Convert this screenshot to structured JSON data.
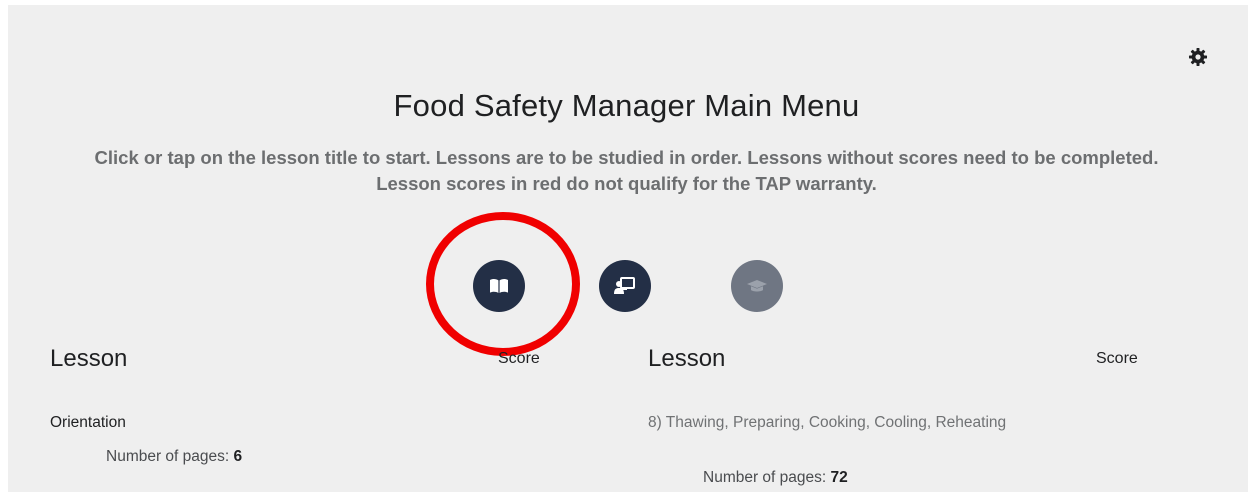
{
  "header": {
    "title": "Food Safety Manager Main Menu",
    "instructions": "Click or tap on the lesson title to start. Lessons are to be studied in order. Lessons without scores need to be completed. Lesson scores in red do not qualify for the TAP warranty."
  },
  "toolbar": {
    "settings_icon": "gear-icon",
    "mode_buttons": [
      {
        "icon": "open-book-icon",
        "state": "active",
        "highlighted": true
      },
      {
        "icon": "presentation-icon",
        "state": "enabled"
      },
      {
        "icon": "graduation-cap-icon",
        "state": "disabled"
      }
    ]
  },
  "columns": [
    {
      "lesson_header": "Lesson",
      "score_header": "Score",
      "lessons": [
        {
          "title": "Orientation",
          "pages_label": "Number of pages: ",
          "pages": "6"
        }
      ]
    },
    {
      "lesson_header": "Lesson",
      "score_header": "Score",
      "lessons": [
        {
          "title": "8) Thawing, Preparing, Cooking, Cooling, Reheating",
          "pages_label": "Number of pages: ",
          "pages": "72"
        }
      ]
    }
  ],
  "colors": {
    "background": "#efefef",
    "button_dark": "#232f46",
    "button_disabled": "#6f7683",
    "highlight": "#f00000",
    "lesson_link_active": "#1f2022",
    "lesson_link_muted": "#707274"
  }
}
